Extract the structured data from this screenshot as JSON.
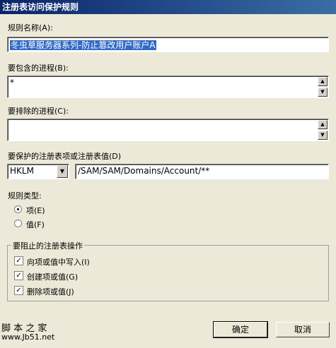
{
  "window": {
    "title": "注册表访问保护规则"
  },
  "rule_name": {
    "label": "规则名称(A):",
    "value": "冬虫草服务器系列-防止篡改用户账户A"
  },
  "include_process": {
    "label": "要包含的进程(B):",
    "value": "*"
  },
  "exclude_process": {
    "label": "要排除的进程(C):",
    "value": ""
  },
  "protect_key": {
    "label": "要保护的注册表项或注册表值(D)",
    "hive": "HKLM",
    "path": "/SAM/SAM/Domains/Account/**"
  },
  "rule_type": {
    "label": "规则类型:",
    "options": [
      {
        "label": "项(E)",
        "selected": true
      },
      {
        "label": "值(F)",
        "selected": false
      }
    ]
  },
  "blocked_ops": {
    "legend": "要阻止的注册表操作",
    "items": [
      {
        "label": "向项或值中写入(I)",
        "checked": true
      },
      {
        "label": "创建项或值(G)",
        "checked": true
      },
      {
        "label": "删除项或值(J)",
        "checked": true
      }
    ]
  },
  "buttons": {
    "ok": "确定",
    "cancel": "取消"
  },
  "watermark": {
    "line1": "脚 本 之 家",
    "line2": "www.Jb51.net"
  }
}
